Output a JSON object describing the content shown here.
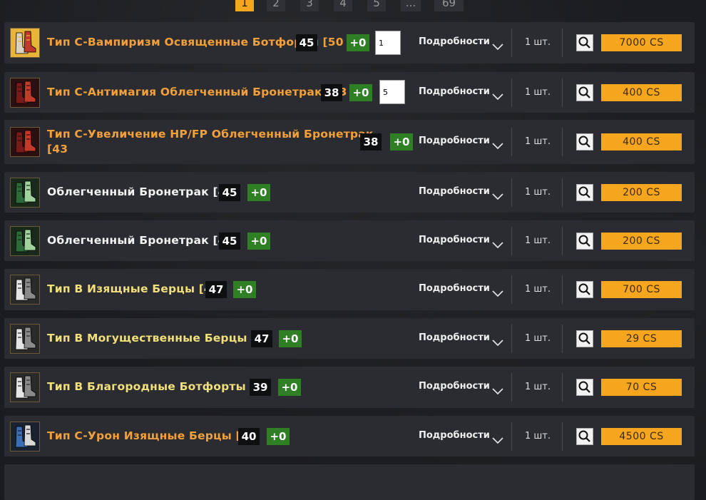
{
  "pagination": {
    "pages": [
      {
        "label": "1",
        "active": true
      },
      {
        "label": "2",
        "active": false
      },
      {
        "label": "3",
        "active": false
      },
      {
        "label": "4",
        "active": false
      },
      {
        "label": "5",
        "active": false
      },
      {
        "label": "...",
        "active": false
      },
      {
        "label": "69",
        "active": false
      }
    ]
  },
  "details_label": "Подробности",
  "items": [
    {
      "name": "Тип C-Вампиризм Освященные Ботфорты [50",
      "name_color": "orange",
      "level": "45",
      "enchant": "+0",
      "count": "1 шт.",
      "price": "7000 CS",
      "qty_value": "1",
      "icon": "boots-gold-icon"
    },
    {
      "name": "Тип C-Антимагия Облегченный Бронетрак [43",
      "name_color": "orange",
      "level": "38",
      "enchant": "+0",
      "count": "1 шт.",
      "price": "400 CS",
      "qty_value": "5",
      "icon": "boots-red-icon"
    },
    {
      "name": "Тип C-Увеличение HP/FP Облегченный Бронетрак",
      "name_line2": "[43",
      "name_color": "orange",
      "level": "38",
      "enchant": "+0",
      "count": "1 шт.",
      "price": "400 CS",
      "icon": "boots-red-icon"
    },
    {
      "name": "Облегченный Бронетрак [45",
      "name_color": "white",
      "level": "45",
      "enchant": "+0",
      "count": "1 шт.",
      "price": "200 CS",
      "icon": "boots-green-icon"
    },
    {
      "name": "Облегченный Бронетрак [45",
      "name_color": "white",
      "level": "45",
      "enchant": "+0",
      "count": "1 шт.",
      "price": "200 CS",
      "icon": "boots-green-icon"
    },
    {
      "name": "Тип B Изящные Берцы [47",
      "name_color": "yellow",
      "level": "47",
      "enchant": "+0",
      "count": "1 шт.",
      "price": "700 CS",
      "icon": "boots-silver-icon"
    },
    {
      "name": "Тип B Могущественные Берцы [47",
      "name_color": "yellow",
      "level": "47",
      "enchant": "+0",
      "count": "1 шт.",
      "price": "29 CS",
      "icon": "boots-silver-icon"
    },
    {
      "name": "Тип B Благородные Ботфорты [39",
      "name_color": "yellow",
      "level": "39",
      "enchant": "+0",
      "count": "1 шт.",
      "price": "70 CS",
      "icon": "boots-silver-icon"
    },
    {
      "name": "Тип C-Урон Изящные Берцы [45",
      "name_color": "orange",
      "level": "40",
      "enchant": "+0",
      "count": "1 шт.",
      "price": "4500 CS",
      "icon": "boots-blue-icon"
    }
  ]
}
